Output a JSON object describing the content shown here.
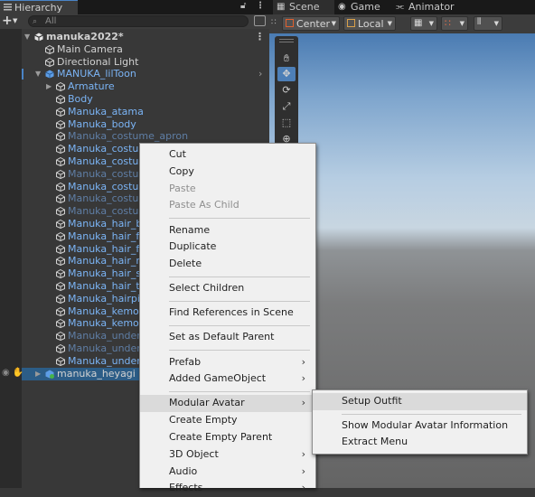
{
  "hierarchy": {
    "tab_label": "Hierarchy",
    "search_placeholder": "All",
    "rows": [
      {
        "label": "manuka2022*",
        "style": "white",
        "indent": 0,
        "expand": "open",
        "icon": "unity-icon"
      },
      {
        "label": "Main Camera",
        "style": "white",
        "indent": 1,
        "expand": "none",
        "icon": "gameobject-icon"
      },
      {
        "label": "Directional Light",
        "style": "white",
        "indent": 1,
        "expand": "none",
        "icon": "gameobject-icon"
      },
      {
        "label": "MANUKA_lilToon",
        "style": "blue",
        "indent": 1,
        "expand": "open",
        "icon": "prefab-icon"
      },
      {
        "label": "Armature",
        "style": "blue",
        "indent": 2,
        "expand": "closed",
        "icon": "gameobject-icon"
      },
      {
        "label": "Body",
        "style": "blue",
        "indent": 2,
        "expand": "none",
        "icon": "gameobject-icon"
      },
      {
        "label": "Manuka_atama",
        "style": "blue",
        "indent": 2,
        "expand": "none",
        "icon": "gameobject-icon"
      },
      {
        "label": "Manuka_body",
        "style": "blue",
        "indent": 2,
        "expand": "none",
        "icon": "gameobject-icon"
      },
      {
        "label": "Manuka_costume_apron",
        "style": "dim",
        "indent": 2,
        "expand": "none",
        "icon": "gameobject-icon"
      },
      {
        "label": "Manuka_costum",
        "style": "blue",
        "indent": 2,
        "expand": "none",
        "icon": "gameobject-icon"
      },
      {
        "label": "Manuka_costum",
        "style": "blue",
        "indent": 2,
        "expand": "none",
        "icon": "gameobject-icon"
      },
      {
        "label": "Manuka_costum",
        "style": "dim",
        "indent": 2,
        "expand": "none",
        "icon": "gameobject-icon"
      },
      {
        "label": "Manuka_costum",
        "style": "blue",
        "indent": 2,
        "expand": "none",
        "icon": "gameobject-icon"
      },
      {
        "label": "Manuka_costum",
        "style": "dim",
        "indent": 2,
        "expand": "none",
        "icon": "gameobject-icon"
      },
      {
        "label": "Manuka_costum",
        "style": "dim",
        "indent": 2,
        "expand": "none",
        "icon": "gameobject-icon"
      },
      {
        "label": "Manuka_hair_bu",
        "style": "blue",
        "indent": 2,
        "expand": "none",
        "icon": "gameobject-icon"
      },
      {
        "label": "Manuka_hair_fro",
        "style": "blue",
        "indent": 2,
        "expand": "none",
        "icon": "gameobject-icon"
      },
      {
        "label": "Manuka_hair_fro",
        "style": "blue",
        "indent": 2,
        "expand": "none",
        "icon": "gameobject-icon"
      },
      {
        "label": "Manuka_hair_rib",
        "style": "blue",
        "indent": 2,
        "expand": "none",
        "icon": "gameobject-icon"
      },
      {
        "label": "Manuka_hair_sid",
        "style": "blue",
        "indent": 2,
        "expand": "none",
        "icon": "gameobject-icon"
      },
      {
        "label": "Manuka_hair_tw",
        "style": "blue",
        "indent": 2,
        "expand": "none",
        "icon": "gameobject-icon"
      },
      {
        "label": "Manuka_hairpin",
        "style": "blue",
        "indent": 2,
        "expand": "none",
        "icon": "gameobject-icon"
      },
      {
        "label": "Manuka_kemon",
        "style": "blue",
        "indent": 2,
        "expand": "none",
        "icon": "gameobject-icon"
      },
      {
        "label": "Manuka_kemon",
        "style": "blue",
        "indent": 2,
        "expand": "none",
        "icon": "gameobject-icon"
      },
      {
        "label": "Manuka_underw",
        "style": "dim",
        "indent": 2,
        "expand": "none",
        "icon": "gameobject-icon"
      },
      {
        "label": "Manuka_underw",
        "style": "dim",
        "indent": 2,
        "expand": "none",
        "icon": "gameobject-icon"
      },
      {
        "label": "Manuka_underw",
        "style": "blue",
        "indent": 2,
        "expand": "none",
        "icon": "gameobject-icon"
      },
      {
        "label": "manuka_heyagi",
        "style": "white",
        "indent": 1,
        "expand": "closed",
        "icon": "prefab-green-icon"
      }
    ]
  },
  "scene_tabs": [
    {
      "label": "Scene",
      "icon": "scene-icon"
    },
    {
      "label": "Game",
      "icon": "game-icon"
    },
    {
      "label": "Animator",
      "icon": "animator-icon"
    }
  ],
  "scene_toolbar": {
    "pivot_label": "Center",
    "space_label": "Local"
  },
  "context_menu": {
    "items": [
      {
        "label": "Cut",
        "enabled": true
      },
      {
        "label": "Copy",
        "enabled": true
      },
      {
        "label": "Paste",
        "enabled": false
      },
      {
        "label": "Paste As Child",
        "enabled": false
      },
      {
        "sep": true
      },
      {
        "label": "Rename",
        "enabled": true
      },
      {
        "label": "Duplicate",
        "enabled": true
      },
      {
        "label": "Delete",
        "enabled": true
      },
      {
        "sep": true
      },
      {
        "label": "Select Children",
        "enabled": true
      },
      {
        "sep": true
      },
      {
        "label": "Find References in Scene",
        "enabled": true
      },
      {
        "sep": true
      },
      {
        "label": "Set as Default Parent",
        "enabled": true
      },
      {
        "sep": true
      },
      {
        "label": "Prefab",
        "enabled": true,
        "submenu": true
      },
      {
        "label": "Added GameObject",
        "enabled": true,
        "submenu": true
      },
      {
        "sep": true
      },
      {
        "label": "Modular Avatar",
        "enabled": true,
        "submenu": true,
        "highlighted": true
      },
      {
        "label": "Create Empty",
        "enabled": true
      },
      {
        "label": "Create Empty Parent",
        "enabled": true
      },
      {
        "label": "3D Object",
        "enabled": true,
        "submenu": true
      },
      {
        "label": "Audio",
        "enabled": true,
        "submenu": true
      },
      {
        "label": "Effects",
        "enabled": true,
        "submenu": true
      }
    ]
  },
  "submenu": {
    "items": [
      {
        "label": "Setup Outfit",
        "highlighted": true
      },
      {
        "sep": true
      },
      {
        "label": "Show Modular Avatar Information"
      },
      {
        "label": "Extract Menu"
      }
    ]
  },
  "colors": {
    "accent": "#4d7fb7",
    "prefab_blue": "#7bb4f5",
    "menu_bg": "#f0f0f0"
  }
}
